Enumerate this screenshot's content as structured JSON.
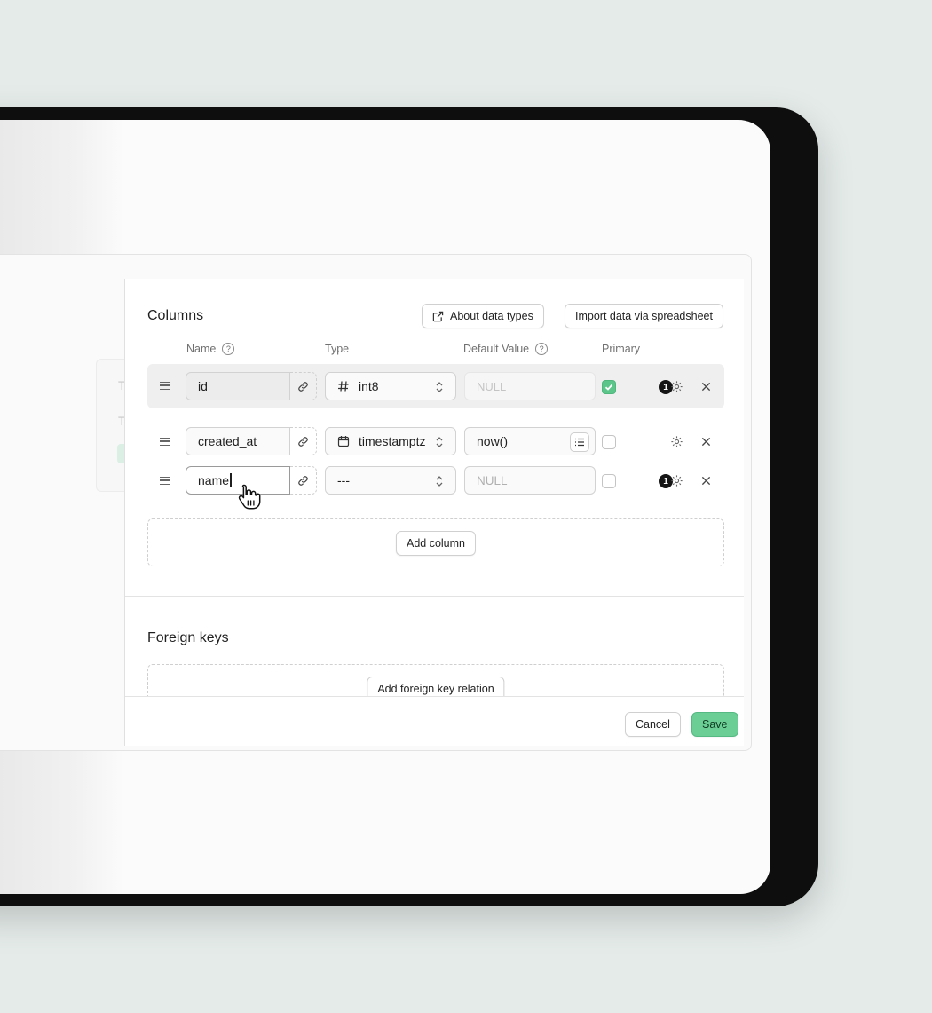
{
  "columns_section": {
    "title": "Columns",
    "about_data_types_label": "About data types",
    "import_label": "Import data via spreadsheet",
    "headers": {
      "name": "Name",
      "type": "Type",
      "default_value": "Default Value",
      "primary": "Primary"
    },
    "help_icon": "?",
    "rows": [
      {
        "name": "id",
        "type_icon": "hash-icon",
        "type": "int8",
        "default_value": "NULL",
        "default_placeholder": true,
        "primary": true,
        "badge": "1"
      },
      {
        "name": "created_at",
        "type_icon": "calendar-icon",
        "type": "timestamptz",
        "default_value": "now()",
        "default_placeholder": false,
        "primary": false,
        "badge": ""
      },
      {
        "name": "name",
        "type_icon": "",
        "type": "---",
        "default_value": "NULL",
        "default_placeholder": true,
        "primary": false,
        "badge": "1"
      }
    ],
    "add_column_label": "Add column"
  },
  "foreign_keys_section": {
    "title": "Foreign keys",
    "add_relation_label": "Add foreign key relation"
  },
  "footer": {
    "cancel_label": "Cancel",
    "save_label": "Save"
  },
  "ghost": {
    "t1": "T",
    "t2": "T"
  },
  "colors": {
    "accent": "#6bcf95",
    "check": "#5cc68a"
  }
}
